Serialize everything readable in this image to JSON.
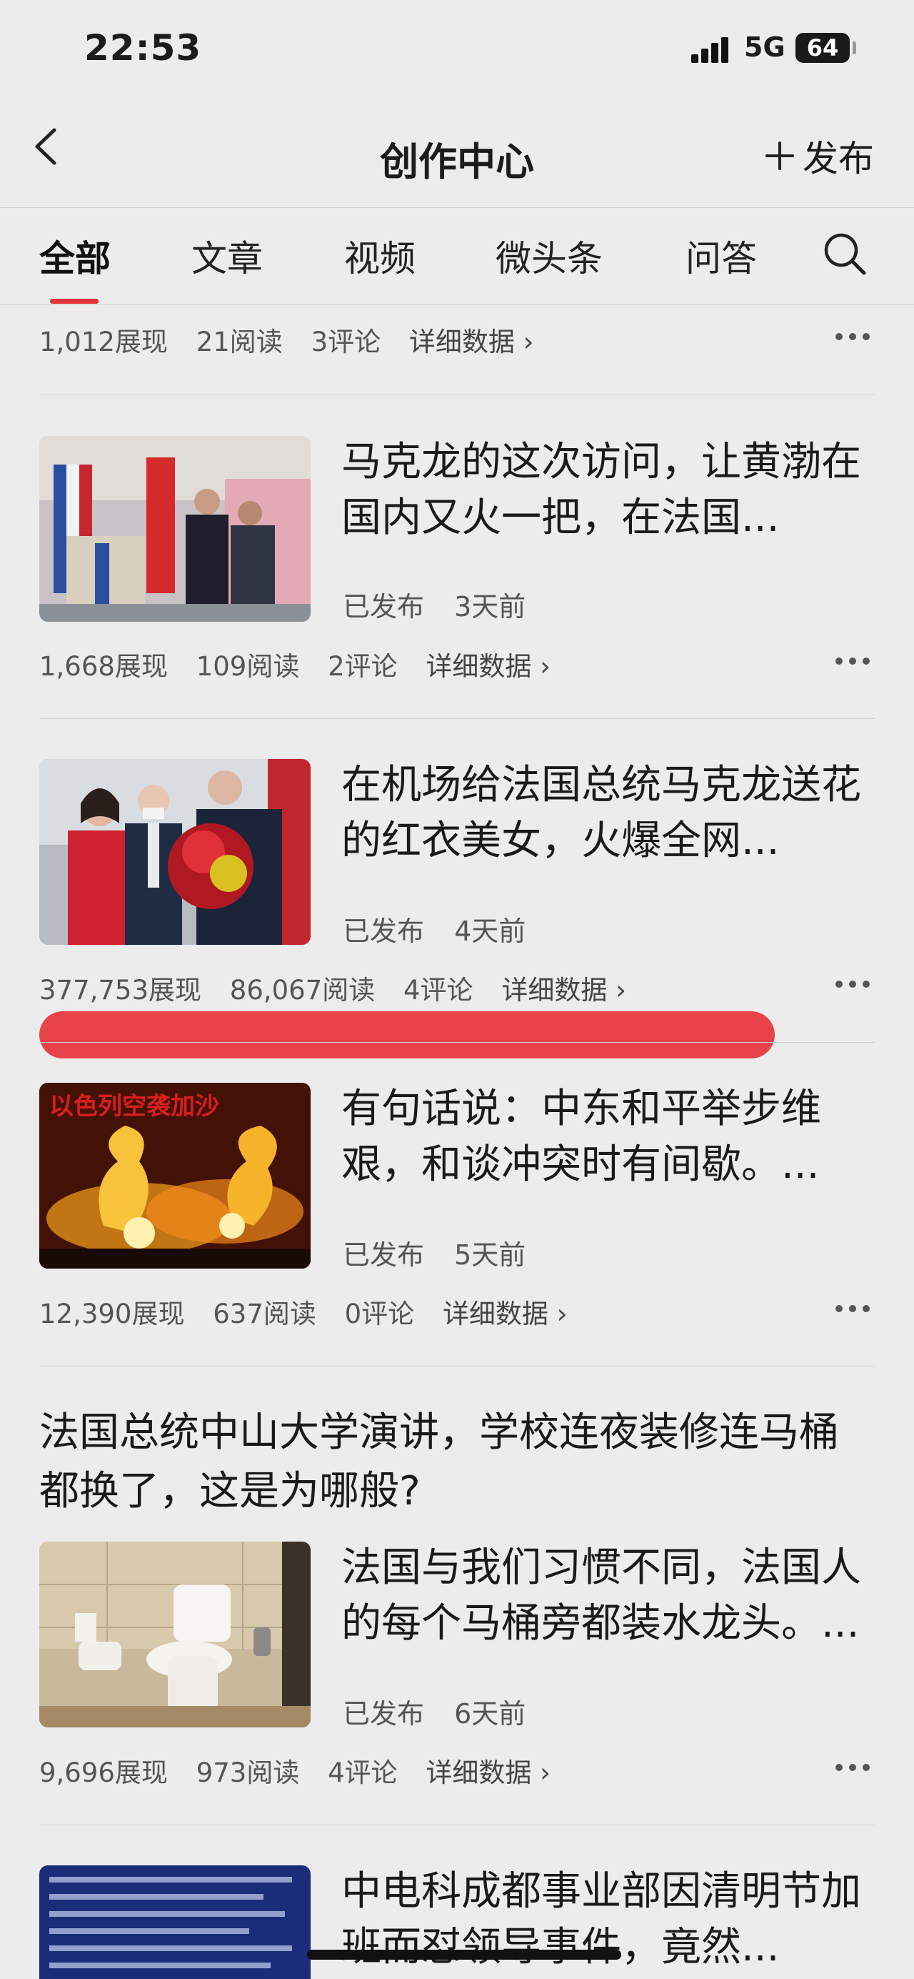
{
  "status": {
    "time": "22:53",
    "network": "5G",
    "battery": "64"
  },
  "nav": {
    "title": "创作中心",
    "publish": "发布"
  },
  "tabs": [
    "全部",
    "文章",
    "视频",
    "微头条",
    "问答"
  ],
  "top_stats": {
    "impressions": "1,012展现",
    "reads": "21阅读",
    "comments": "3评论",
    "detail": "详细数据 ›"
  },
  "articles": [
    {
      "title": "马克龙的这次访问，让黄渤在国内又火一把，在法国...",
      "status": "已发布",
      "time": "3天前",
      "impressions": "1,668展现",
      "reads": "109阅读",
      "comments": "2评论",
      "detail": "详细数据 ›"
    },
    {
      "title": "在机场给法国总统马克龙送花的红衣美女，火爆全网...",
      "status": "已发布",
      "time": "4天前",
      "impressions": "377,753展现",
      "reads": "86,067阅读",
      "comments": "4评论",
      "detail": "详细数据 ›"
    },
    {
      "title": "有句话说：中东和平举步维艰，和谈冲突时有间歇。...",
      "status": "已发布",
      "time": "5天前",
      "impressions": "12,390展现",
      "reads": "637阅读",
      "comments": "0评论",
      "detail": "详细数据 ›",
      "thumb_text": "以色列空袭加沙"
    },
    {
      "headline": "法国总统中山大学演讲，学校连夜装修连马桶都换了，这是为哪般?",
      "title": "法国与我们习惯不同，法国人的每个马桶旁都装水龙头。...",
      "status": "已发布",
      "time": "6天前",
      "impressions": "9,696展现",
      "reads": "973阅读",
      "comments": "4评论",
      "detail": "详细数据 ›"
    },
    {
      "title": "中电科成都事业部因清明节加班而怼领导事件，竟然..."
    }
  ],
  "colors": {
    "accent": "#e0343a",
    "highlight_bar": "#e8434a",
    "background": "#ececec"
  }
}
